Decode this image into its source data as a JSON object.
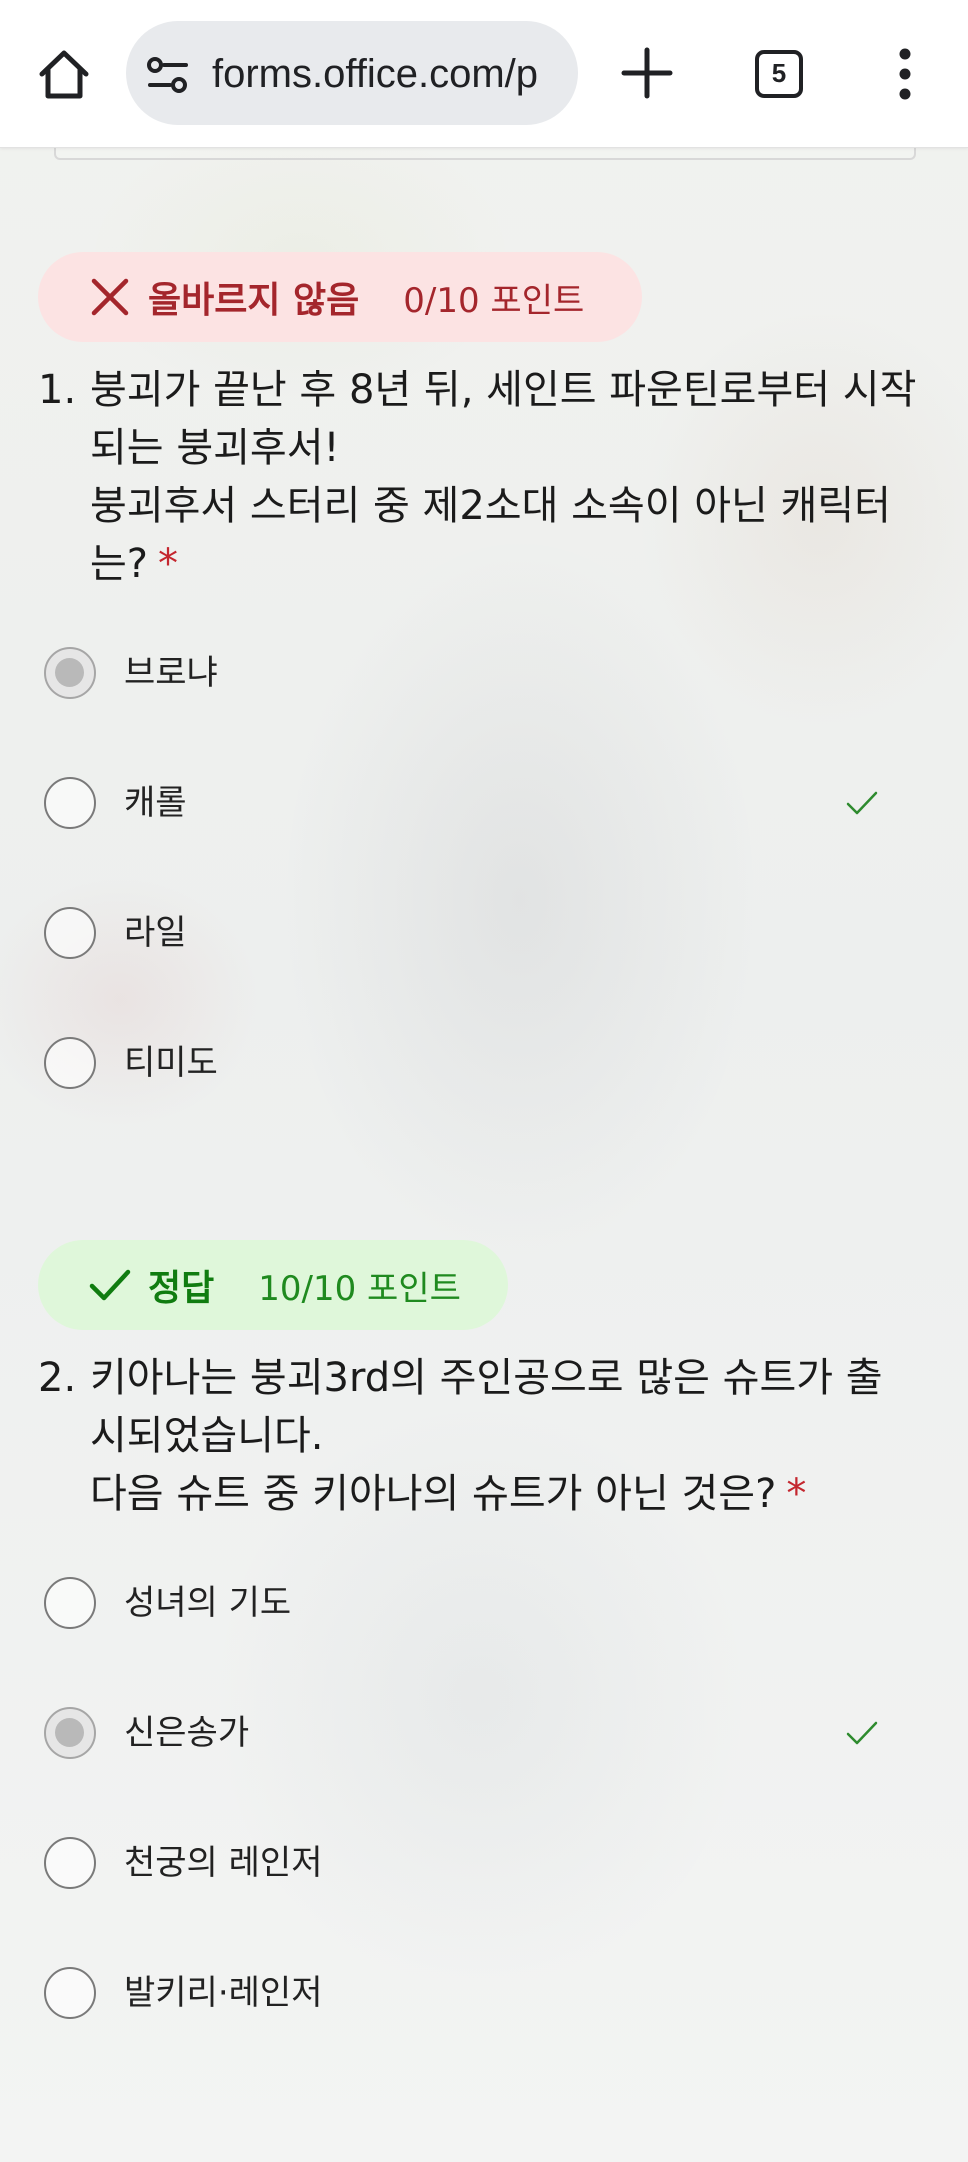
{
  "browser": {
    "url": "forms.office.com/p",
    "tab_count": "5"
  },
  "questions": [
    {
      "status": "올바르지 않음",
      "points": "0/10 포인트",
      "number": "1.",
      "lines": [
        "붕괴가 끝난 후 8년 뒤, 세인트 파운틴로부터 시작",
        "되는 붕괴후서!",
        "붕괴후서 스터리 중 제2소대 소속이 아닌 캐릭터",
        "는?"
      ],
      "required_mark": "*",
      "options": [
        {
          "label": "브로냐",
          "selected": true,
          "correct": false
        },
        {
          "label": "캐롤",
          "selected": false,
          "correct": true
        },
        {
          "label": "라일",
          "selected": false,
          "correct": false
        },
        {
          "label": "티미도",
          "selected": false,
          "correct": false
        }
      ]
    },
    {
      "status": "정답",
      "points": "10/10 포인트",
      "number": "2.",
      "lines": [
        "키아나는 붕괴3rd의 주인공으로 많은 슈트가 출",
        "시되었습니다.",
        "다음 슈트 중 키아나의 슈트가 아닌 것은?"
      ],
      "required_mark": "*",
      "options": [
        {
          "label": "성녀의 기도",
          "selected": false,
          "correct": false
        },
        {
          "label": "신은송가",
          "selected": true,
          "correct": true
        },
        {
          "label": "천궁의 레인저",
          "selected": false,
          "correct": false
        },
        {
          "label": "발키리·레인저",
          "selected": false,
          "correct": false
        }
      ]
    }
  ],
  "colors": {
    "wrong_badge_bg": "#fce3e3",
    "wrong_text": "#a4262c",
    "right_badge_bg": "#dff7da",
    "right_text": "#107c10",
    "required": "#c4262e"
  },
  "icons": [
    "home-icon",
    "site-settings-icon",
    "plus-icon",
    "tab-switcher-icon",
    "more-vert-icon",
    "close-icon",
    "check-icon"
  ]
}
